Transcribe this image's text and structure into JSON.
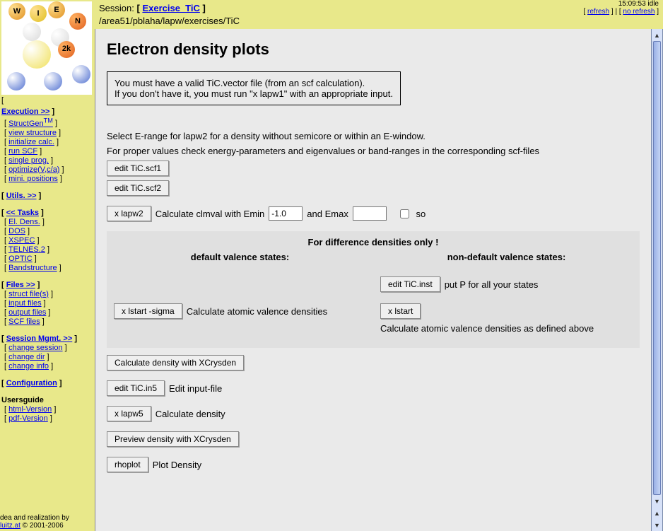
{
  "sidebar": {
    "execution_head": "Execution >>",
    "structgen": "StructGen",
    "structgen_sup": "TM",
    "view_structure": "view structure",
    "initialize_calc": "initialize calc.",
    "run_scf": "run SCF",
    "single_prog": "single prog.",
    "optimize": "optimize(V,c/a)",
    "mini_positions": "mini. positions",
    "utils_head": "Utils. >>",
    "tasks_head": "<< Tasks",
    "el_dens": "El. Dens.",
    "dos": "DOS",
    "xspec": "XSPEC",
    "telnes": "TELNES.2",
    "optic": "OPTIC",
    "bandstructure": "Bandstructure",
    "files_head": "Files >>",
    "struct_files": "struct file(s)",
    "input_files": "input files",
    "output_files": "output files",
    "scf_files": "SCF files",
    "session_head": "Session Mgmt. >>",
    "change_session": "change session",
    "change_dir": "change dir",
    "change_info": "change info",
    "configuration": "Configuration",
    "usersguide": "Usersguide",
    "html_version": "html-Version",
    "pdf_version": "pdf-Version",
    "footer_idea": "dea and realization by",
    "footer_link": "luitz.at",
    "footer_c": " © 2001-2006"
  },
  "topbar": {
    "session_label": "Session: ",
    "session_name": "Exercise_TiC",
    "path": "/area51/pblaha/lapw/exercises/TiC",
    "clock": "15:09:53 idle",
    "refresh": "refresh",
    "no_refresh": "no refresh"
  },
  "main": {
    "title": "Electron density plots",
    "notice1": "You must have a valid TiC.vector file (from an scf calculation).",
    "notice2": "If you don't have it, you must run \"x lapw1\" with an appropriate input.",
    "select_text1": "Select E-range for lapw2 for a density without semicore or within an E-window.",
    "select_text2": "For proper values check energy-parameters and eigenvalues or band-ranges in the corresponding scf-files",
    "edit_scf1": "edit TiC.scf1",
    "edit_scf2": "edit TiC.scf2",
    "xlapw2": "x lapw2",
    "clmval_text": "Calculate clmval with Emin",
    "emin_value": "-1.0",
    "and_emax": "and Emax",
    "so_label": "so",
    "diff_header": "For difference densities only !",
    "default_head": "default valence states:",
    "nondefault_head": "non-default valence states:",
    "edit_inst": "edit TiC.inst",
    "put_p_text": "put P for all your states",
    "x_lstart_sigma": "x lstart -sigma",
    "calc_atomic": "Calculate atomic valence densities",
    "x_lstart": "x lstart",
    "calc_atomic_def": "Calculate atomic valence densities as defined above",
    "calc_xcrysden": "Calculate density with XCrysden",
    "edit_in5": "edit TiC.in5",
    "edit_inputfile": "Edit input-file",
    "xlapw5": "x lapw5",
    "calc_density": "Calculate density",
    "preview_xcrysden": "Preview density with XCrysden",
    "rhoplot": "rhoplot",
    "plot_density": "Plot Density"
  }
}
